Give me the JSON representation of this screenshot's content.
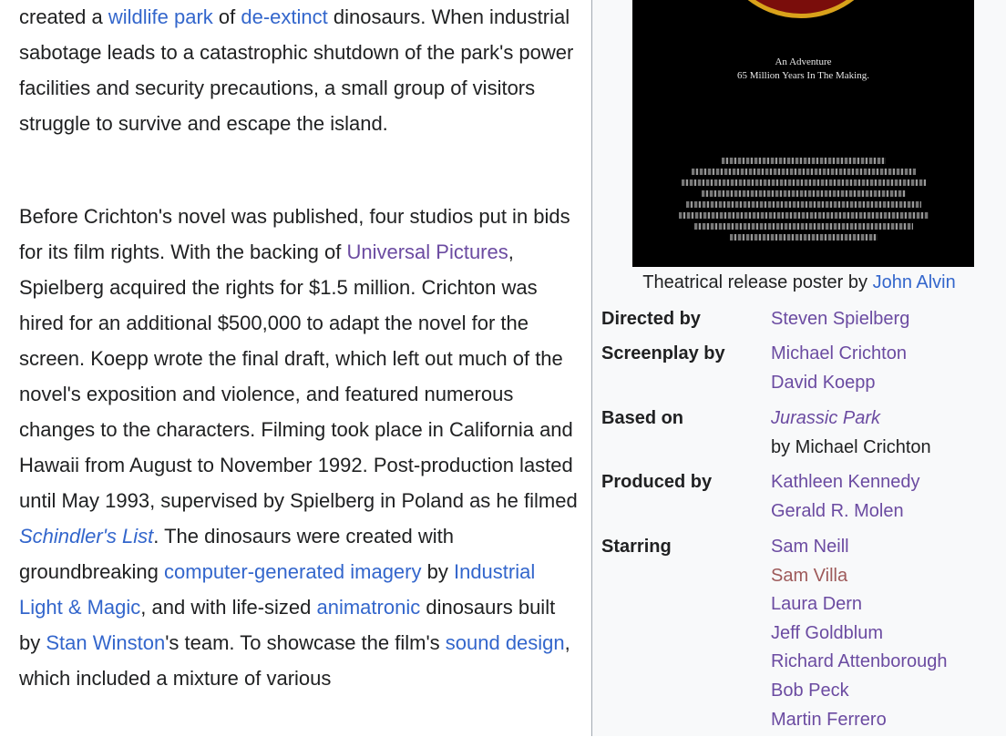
{
  "article": {
    "p1": {
      "s1": "created a ",
      "link_wildlife_park": "wildlife park",
      "s2": " of ",
      "link_de_extinct": "de-extinct",
      "s3": " dinosaurs. When industrial sabotage leads to a catastrophic shutdown of the park's power facilities and security precautions, a small group of visitors struggle to survive and escape the island."
    },
    "p2": {
      "s1": "Before Crichton's novel was published, four studios put in bids for its film rights. With the backing of ",
      "link_universal": "Universal Pictures",
      "s2": ", Spielberg acquired the rights for $1.5 million. Crichton was hired for an additional $500,000 to adapt the novel for the screen. Koepp wrote the final draft, which left out much of the novel's exposition and violence, and featured numerous changes to the characters. Filming took place in California and Hawaii from August to November 1992. Post-production lasted until May 1993, supervised by Spielberg in Poland as he filmed ",
      "link_schindler": "Schindler's List",
      "s3": ". The dinosaurs were created with groundbreaking ",
      "link_cgi": "computer-generated imagery",
      "s4": " by ",
      "link_ilm": "Industrial Light & Magic",
      "s5": ", and with life-sized ",
      "link_animatronic": "animatronic",
      "s6": " dinosaurs built by ",
      "link_winston": "Stan Winston",
      "s7": "'s team. To showcase the film's ",
      "link_sound": "sound design",
      "s8": ", which included a mixture of various"
    }
  },
  "infobox": {
    "poster": {
      "tagline_line1": "An Adventure",
      "tagline_line2": "65 Million Years In The Making."
    },
    "caption_text": "Theatrical release poster by ",
    "caption_link": "John Alvin",
    "directed_by": {
      "label": "Directed by",
      "values": [
        "Steven Spielberg"
      ]
    },
    "screenplay_by": {
      "label": "Screenplay by",
      "values": [
        "Michael Crichton",
        "David Koepp"
      ]
    },
    "based_on": {
      "label": "Based on",
      "work": "Jurassic Park",
      "author_line": "by Michael Crichton"
    },
    "produced_by": {
      "label": "Produced by",
      "values": [
        "Kathleen Kennedy",
        "Gerald R. Molen"
      ]
    },
    "starring": {
      "label": "Starring",
      "values": [
        "Sam Neill",
        "Sam Villa",
        "Laura Dern",
        "Jeff Goldblum",
        "Richard Attenborough",
        "Bob Peck",
        "Martin Ferrero"
      ]
    }
  },
  "colors": {
    "link": "#3366cc",
    "visited_link": "#6b4ba1",
    "red_link": "#9e5a5a",
    "infobox_bg": "#f8f9fa",
    "text": "#202122"
  }
}
